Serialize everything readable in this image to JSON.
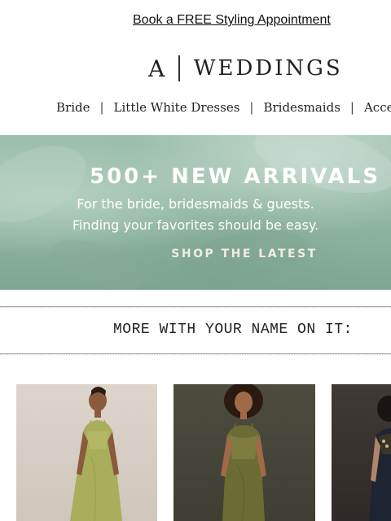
{
  "promo": {
    "link_label": "Book a FREE Styling Appointment"
  },
  "logo": {
    "mark": "A",
    "text": "WEDDINGS"
  },
  "nav": {
    "items": [
      {
        "label": "Bride"
      },
      {
        "label": "Little White Dresses"
      },
      {
        "label": "Bridesmaids"
      },
      {
        "label": "Acces"
      }
    ],
    "separator": "|"
  },
  "hero": {
    "headline": "500+ NEW ARRIVALS",
    "subline_1": "For the bride, bridesmaids & guests.",
    "subline_2": "Finding your favorites should be easy.",
    "cta": "SHOP THE LATEST"
  },
  "section": {
    "heading": "MORE WITH YOUR NAME ON IT:"
  },
  "colors": {
    "hero_green": "#8fb5a2",
    "dress_green": "#9aa24f",
    "olive_dress": "#6b6c34",
    "navy_dress": "#1f2433"
  }
}
